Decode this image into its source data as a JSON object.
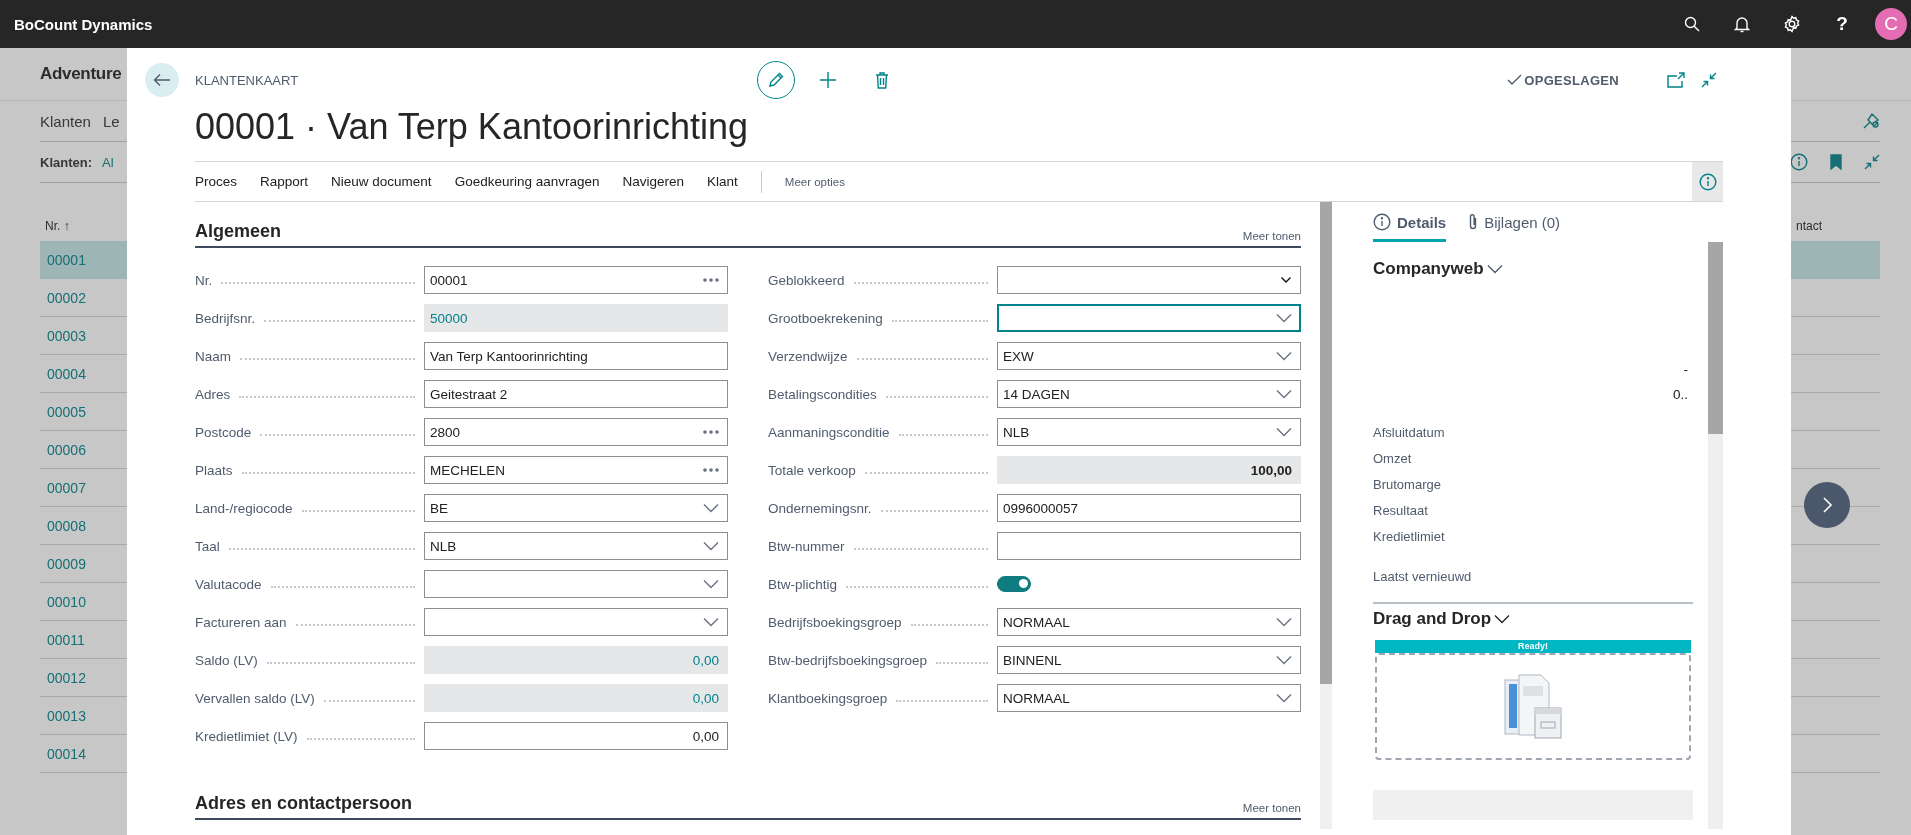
{
  "app_bar": {
    "title": "BoCount Dynamics",
    "help_glyph": "?",
    "avatar": "C"
  },
  "background_page": {
    "title": "Adventure",
    "nav": [
      "Klanten",
      "Le"
    ],
    "filter_label": "Klanten:",
    "filter_value": "Al",
    "columns": [
      "Nr. ↑",
      "ntact"
    ],
    "rows": [
      {
        "number": "00001",
        "selected": true
      },
      {
        "number": "00002",
        "selected": false
      },
      {
        "number": "00003",
        "selected": false
      },
      {
        "number": "00004",
        "selected": false
      },
      {
        "number": "00005",
        "selected": false
      },
      {
        "number": "00006",
        "selected": false
      },
      {
        "number": "00007",
        "selected": false
      },
      {
        "number": "00008",
        "selected": false
      },
      {
        "number": "00009",
        "selected": false
      },
      {
        "number": "00010",
        "selected": false
      },
      {
        "number": "00011",
        "selected": false
      },
      {
        "number": "00012",
        "selected": false
      },
      {
        "number": "00013",
        "selected": false
      },
      {
        "number": "00014",
        "selected": false
      }
    ]
  },
  "card": {
    "caption": "KLANTENKAART",
    "title": "00001 · Van Terp Kantoorinrichting",
    "status": "OPGESLAGEN",
    "actions": [
      {
        "label": "Proces",
        "kind": "menu"
      },
      {
        "label": "Rapport",
        "kind": "menu"
      },
      {
        "label": "Nieuw document",
        "kind": "menu"
      },
      {
        "label": "Goedkeuring aanvragen",
        "kind": "menu"
      },
      {
        "label": "Navigeren",
        "kind": "menu"
      },
      {
        "label": "Klant",
        "kind": "menu"
      },
      {
        "label": "Meer opties",
        "kind": "more"
      }
    ],
    "sections": [
      {
        "title": "Algemeen",
        "more": "Meer tonen",
        "columns": [
          [
            {
              "label": "Nr.",
              "value": "00001",
              "kind": "lookup",
              "focused": false
            },
            {
              "label": "Bedrijfsnr.",
              "value": "50000",
              "kind": "drilldown",
              "focused": false
            },
            {
              "label": "Naam",
              "value": "Van Terp Kantoorinrichting",
              "kind": "text",
              "focused": false
            },
            {
              "label": "Adres",
              "value": "Geitestraat 2",
              "kind": "text",
              "focused": false
            },
            {
              "label": "Postcode",
              "value": "2800",
              "kind": "lookup",
              "focused": false
            },
            {
              "label": "Plaats",
              "value": "MECHELEN",
              "kind": "lookup",
              "focused": false
            },
            {
              "label": "Land-/regiocode",
              "value": "BE",
              "kind": "select",
              "focused": false
            },
            {
              "label": "Taal",
              "value": "NLB",
              "kind": "select",
              "focused": false
            },
            {
              "label": "Valutacode",
              "kind": "select",
              "focused": false
            },
            {
              "label": "Factureren aan",
              "kind": "select",
              "focused": false
            },
            {
              "label": "Saldo (LV)",
              "value": "0,00",
              "kind": "drilldown-amount",
              "focused": false
            },
            {
              "label": "Vervallen saldo (LV)",
              "value": "0,00",
              "kind": "drilldown-amount",
              "focused": false
            },
            {
              "label": "Kredietlimiet (LV)",
              "value": "0,00",
              "kind": "amount",
              "focused": false
            }
          ],
          [
            {
              "label": "Geblokkeerd",
              "kind": "dropdown",
              "focused": false
            },
            {
              "label": "Grootboekrekening",
              "kind": "select",
              "focused": true
            },
            {
              "label": "Verzendwijze",
              "value": "EXW",
              "kind": "select",
              "focused": false
            },
            {
              "label": "Betalingscondities",
              "value": "14 DAGEN",
              "kind": "select",
              "focused": false
            },
            {
              "label": "Aanmaningsconditie",
              "value": "NLB",
              "kind": "select",
              "focused": false
            },
            {
              "label": "Totale verkoop",
              "value": "100,00",
              "kind": "total",
              "focused": false
            },
            {
              "label": "Ondernemingsnr.",
              "value": "0996000057",
              "kind": "text",
              "focused": false
            },
            {
              "label": "Btw-nummer",
              "kind": "text",
              "focused": false
            },
            {
              "label": "Btw-plichtig",
              "kind": "toggle",
              "on": true
            },
            {
              "label": "Bedrijfsboekingsgroep",
              "value": "NORMAAL",
              "kind": "select",
              "focused": false
            },
            {
              "label": "Btw-bedrijfsboekingsgroep",
              "value": "BINNENL",
              "kind": "select",
              "focused": false
            },
            {
              "label": "Klantboekingsgroep",
              "value": "NORMAAL",
              "kind": "select",
              "focused": false
            }
          ]
        ]
      },
      {
        "title": "Adres en contactpersoon",
        "more": "Meer tonen"
      }
    ]
  },
  "factbox": {
    "tabs": [
      {
        "label": "Details",
        "selected": true
      },
      {
        "label": "Bijlagen (0)",
        "selected": false
      }
    ],
    "companyweb": {
      "title": "Companyweb",
      "values": [
        "-",
        "0.."
      ],
      "labels": [
        "Afsluitdatum",
        "Omzet",
        "Brutomarge",
        "Resultaat",
        "Kredietlimiet"
      ],
      "refreshed": "Laatst vernieuwd"
    },
    "drag_drop": {
      "title": "Drag and Drop",
      "status": "Ready!"
    }
  }
}
